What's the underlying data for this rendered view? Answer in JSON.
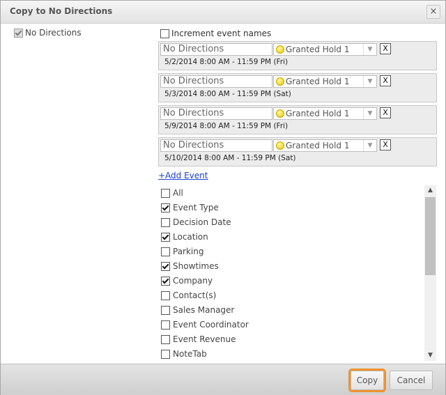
{
  "dialog": {
    "title": "Copy to No Directions",
    "close_label": "×"
  },
  "source_option": {
    "label": "No Directions",
    "checked": true
  },
  "increment": {
    "label": "Increment event names",
    "checked": false
  },
  "events": [
    {
      "name": "No Directions",
      "status": "Granted Hold 1",
      "date": "5/2/2014 8:00 AM - 11:59 PM (Fri)"
    },
    {
      "name": "No Directions",
      "status": "Granted Hold 1",
      "date": "5/3/2014 8:00 AM - 11:59 PM (Sat)"
    },
    {
      "name": "No Directions",
      "status": "Granted Hold 1",
      "date": "5/9/2014 8:00 AM - 11:59 PM (Fri)"
    },
    {
      "name": "No Directions",
      "status": "Granted Hold 1",
      "date": "5/10/2014 8:00 AM - 11:59 PM (Sat)"
    }
  ],
  "remove_label": "X",
  "add_event_label": "+Add Event",
  "fields": [
    {
      "label": "All",
      "checked": false
    },
    {
      "label": "Event Type",
      "checked": true
    },
    {
      "label": "Decision Date",
      "checked": false
    },
    {
      "label": "Location",
      "checked": true
    },
    {
      "label": "Parking",
      "checked": false
    },
    {
      "label": "Showtimes",
      "checked": true
    },
    {
      "label": "Company",
      "checked": true
    },
    {
      "label": "Contact(s)",
      "checked": false
    },
    {
      "label": "Sales Manager",
      "checked": false
    },
    {
      "label": "Event Coordinator",
      "checked": false
    },
    {
      "label": "Event Revenue",
      "checked": false
    },
    {
      "label": "NoteTab",
      "checked": false
    }
  ],
  "footer": {
    "copy_label": "Copy",
    "cancel_label": "Cancel"
  },
  "colors": {
    "accent": "#f0932e",
    "link": "#1a3fcf",
    "status_dot": "#e3c80b"
  }
}
